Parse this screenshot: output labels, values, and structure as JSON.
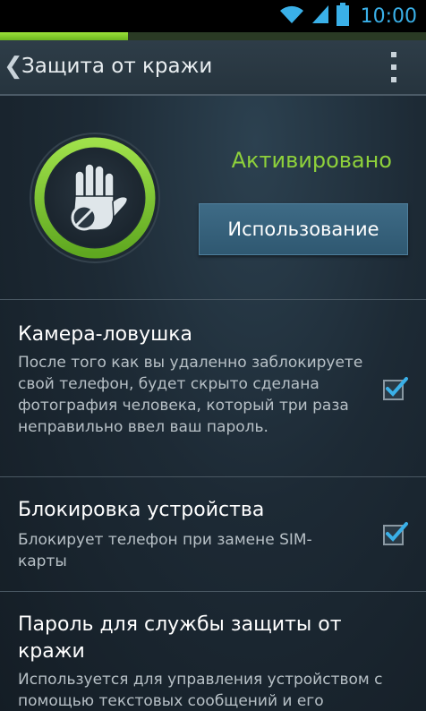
{
  "status_bar": {
    "time": "10:00",
    "icons": [
      "wifi-icon",
      "signal-icon",
      "battery-icon"
    ]
  },
  "strip": {
    "progress_fraction": 0.3
  },
  "action_bar": {
    "back_glyph": "❮",
    "title": "Защита от кражи"
  },
  "hero": {
    "status_text": "Активировано",
    "usage_button_label": "Использование"
  },
  "settings": [
    {
      "title": "Камера-ловушка",
      "description": "После того как вы удаленно заблокируете свой телефон, будет скрыто сделана фотография человека, который три раза неправильно ввел ваш пароль.",
      "checked": true
    },
    {
      "title": "Блокировка устройства",
      "description": "Блокирует телефон при замене SIM-карты",
      "checked": true
    },
    {
      "title": "Пароль для службы защиты от кражи",
      "description": "Используется для управления устройством с помощью текстовых сообщений и его"
    }
  ],
  "colors": {
    "accent_green": "#8ed13b",
    "accent_blue": "#3ab0e8",
    "button_blue": "#356180"
  }
}
